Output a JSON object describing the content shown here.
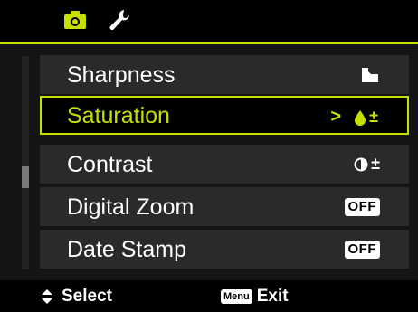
{
  "colors": {
    "accent": "#c8e000",
    "row_bg": "#2a2a2a",
    "panel_bg": "#151515"
  },
  "tabs": [
    {
      "icon": "camera-icon",
      "active": true
    },
    {
      "icon": "wrench-icon",
      "active": false
    }
  ],
  "menu": {
    "items": [
      {
        "label": "Sharpness",
        "value_icon": "sharpness-icon"
      },
      {
        "label": "Saturation",
        "value_icon": "saturation-drop-icon",
        "value_sign": "±",
        "selected": true,
        "arrow": ">"
      },
      {
        "label": "Contrast",
        "value_icon": "contrast-icon",
        "value_sign": "±"
      },
      {
        "label": "Digital Zoom",
        "value": "OFF"
      },
      {
        "label": "Date Stamp",
        "value": "OFF"
      }
    ]
  },
  "footer": {
    "select_label": "Select",
    "menu_key": "Menu",
    "exit_label": "Exit"
  }
}
